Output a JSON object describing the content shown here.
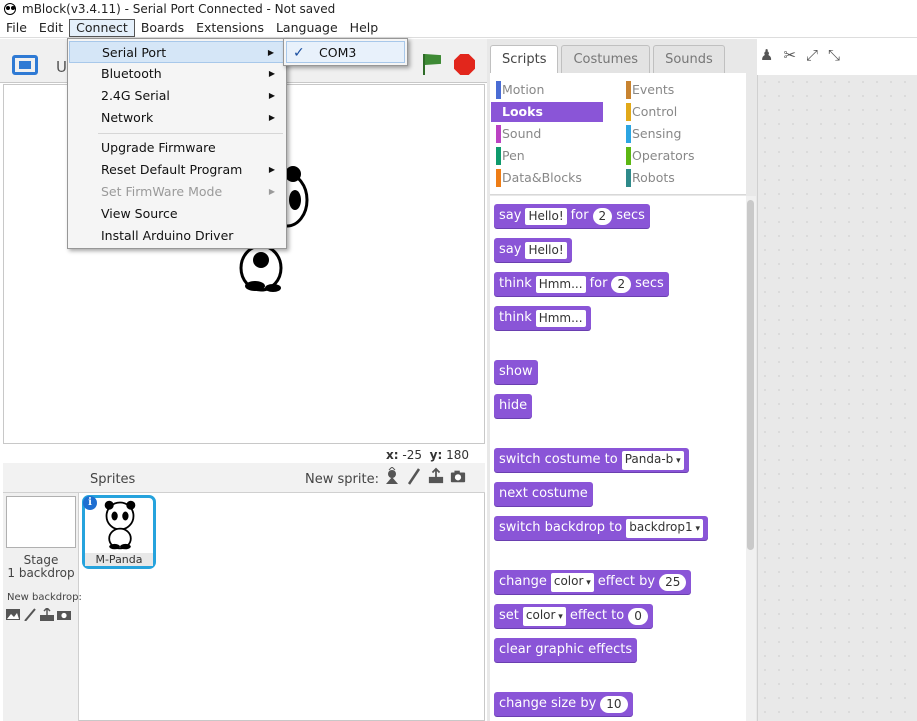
{
  "window": {
    "title": "mBlock(v3.4.11) - Serial Port Connected - Not saved"
  },
  "menubar": {
    "items": [
      "File",
      "Edit",
      "Connect",
      "Boards",
      "Extensions",
      "Language",
      "Help"
    ]
  },
  "stage": {
    "title_partial": "U",
    "coords": {
      "x_label": "x:",
      "x_value": "-25",
      "y_label": "y:",
      "y_value": "180"
    }
  },
  "connect_menu": {
    "items": [
      {
        "label": "Serial Port",
        "submenu": true
      },
      {
        "label": "Bluetooth",
        "submenu": true
      },
      {
        "label": "2.4G Serial",
        "submenu": true
      },
      {
        "label": "Network",
        "submenu": true
      },
      {
        "label": "Upgrade Firmware"
      },
      {
        "label": "Reset Default Program",
        "submenu": true
      },
      {
        "label": "Set FirmWare Mode",
        "submenu": true,
        "disabled": true
      },
      {
        "label": "View Source"
      },
      {
        "label": "Install Arduino Driver"
      }
    ],
    "serial_submenu": {
      "check": "✓",
      "port": "COM3"
    }
  },
  "sprites": {
    "header": "Sprites",
    "new_sprite": "New sprite:",
    "stage_name": "Stage",
    "stage_backdrops": "1 backdrop",
    "new_backdrop": "New backdrop:",
    "sprite_name": "M-Panda",
    "info": "i"
  },
  "tabs": [
    "Scripts",
    "Costumes",
    "Sounds"
  ],
  "categories": [
    {
      "label": "Motion",
      "color": "#4a6cd4"
    },
    {
      "label": "Events",
      "color": "#c88330"
    },
    {
      "label": "Looks",
      "color": "#8a55d7",
      "active": true
    },
    {
      "label": "Control",
      "color": "#e1a91a"
    },
    {
      "label": "Sound",
      "color": "#bb42c3"
    },
    {
      "label": "Sensing",
      "color": "#2ca5e2"
    },
    {
      "label": "Pen",
      "color": "#0e9a6c"
    },
    {
      "label": "Operators",
      "color": "#5cb712"
    },
    {
      "label": "Data&Blocks",
      "color": "#ee7d16"
    },
    {
      "label": "Robots",
      "color": "#2e8a8a"
    }
  ],
  "blocks": {
    "say1": {
      "a": "say",
      "f1": "Hello!",
      "b": "for",
      "f2": "2",
      "c": "secs"
    },
    "say2": {
      "a": "say",
      "f1": "Hello!"
    },
    "think1": {
      "a": "think",
      "f1": "Hmm...",
      "b": "for",
      "f2": "2",
      "c": "secs"
    },
    "think2": {
      "a": "think",
      "f1": "Hmm..."
    },
    "show": "show",
    "hide": "hide",
    "switch_costume": {
      "a": "switch costume to",
      "d": "Panda-b"
    },
    "next_costume": "next costume",
    "switch_backdrop": {
      "a": "switch backdrop to",
      "d": "backdrop1"
    },
    "change_effect": {
      "a": "change",
      "d": "color",
      "b": "effect by",
      "f": "25"
    },
    "set_effect": {
      "a": "set",
      "d": "color",
      "b": "effect to",
      "f": "0"
    },
    "clear_effects": "clear graphic effects",
    "change_size": {
      "a": "change size by",
      "f": "10"
    }
  },
  "colors": {
    "looks": "#8a55d7",
    "accent_blue": "#26a3dd",
    "stop_red": "#e2261c",
    "flag_green": "#3e8a35"
  }
}
